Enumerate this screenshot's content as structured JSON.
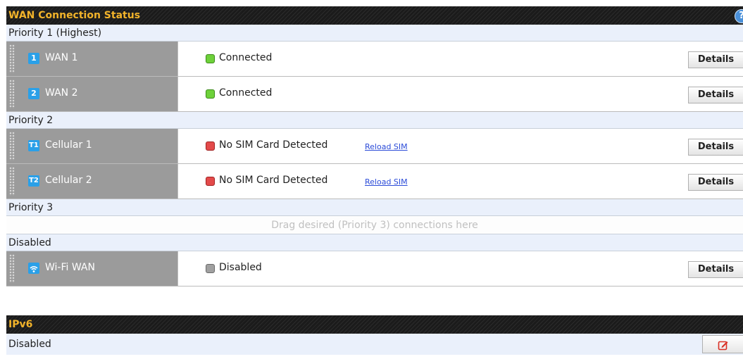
{
  "wan_panel": {
    "title": "WAN Connection Status",
    "help_icon": "?",
    "groups": [
      {
        "label": "Priority 1 (Highest)",
        "connections": [
          {
            "icon": "1",
            "icon_name": "wan-number-icon",
            "name": "WAN 1",
            "status": "Connected",
            "status_color": "#6ed13a",
            "details": "Details"
          },
          {
            "icon": "2",
            "icon_name": "wan-number-icon",
            "name": "WAN 2",
            "status": "Connected",
            "status_color": "#6ed13a",
            "details": "Details"
          }
        ]
      },
      {
        "label": "Priority 2",
        "connections": [
          {
            "icon": "T1",
            "icon_name": "cellular-antenna-icon",
            "name": "Cellular 1",
            "status": "No SIM Card Detected",
            "status_color": "#e34a4a",
            "link": "Reload SIM",
            "details": "Details"
          },
          {
            "icon": "T2",
            "icon_name": "cellular-antenna-icon",
            "name": "Cellular 2",
            "status": "No SIM Card Detected",
            "status_color": "#e34a4a",
            "link": "Reload SIM",
            "details": "Details"
          }
        ]
      },
      {
        "label": "Priority 3",
        "drop_hint": "Drag desired (Priority 3) connections here"
      },
      {
        "label": "Disabled",
        "connections": [
          {
            "icon": "wifi",
            "icon_name": "wifi-icon",
            "name": "Wi-Fi WAN",
            "status": "Disabled",
            "status_color": "#a0a0a0",
            "details": "Details"
          }
        ]
      }
    ]
  },
  "ipv6_panel": {
    "title": "IPv6",
    "value": "Disabled",
    "edit_icon": "edit-icon"
  },
  "colors": {
    "header_bg": "#1b1b1b",
    "header_text": "#f2b32a",
    "priority_bg": "#eaf0fb",
    "connection_name_bg": "#9b9b9b",
    "link": "#2b4bd8"
  }
}
